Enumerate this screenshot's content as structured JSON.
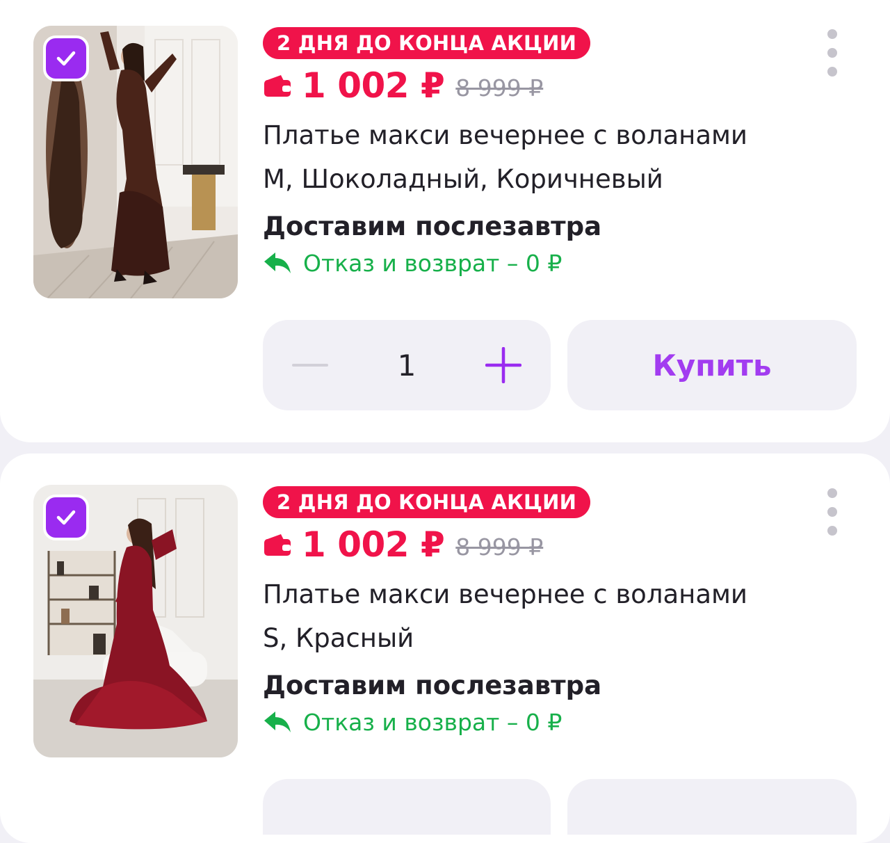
{
  "colors": {
    "accent_purple": "#9a2bf0",
    "sale_red": "#f0134a",
    "refund_green": "#17b04a",
    "old_price_gray": "#9896a2",
    "page_bg": "#f1f0f6"
  },
  "products": [
    {
      "selected": true,
      "promo_label": "2 ДНЯ ДО КОНЦА АКЦИИ",
      "price": "1 002 ₽",
      "old_price": "8 999 ₽",
      "title": "Платье макси вечернее с воланами",
      "variant": "M, Шоколадный, Коричневый",
      "delivery": "Доставим послезавтра",
      "refund": "Отказ и возврат – 0 ₽",
      "quantity": "1",
      "buy_label": "Купить",
      "icons": [
        "check-icon",
        "wallet-icon",
        "return-arrow-icon",
        "more-dots-icon",
        "minus-icon",
        "plus-icon"
      ]
    },
    {
      "selected": true,
      "promo_label": "2 ДНЯ ДО КОНЦА АКЦИИ",
      "price": "1 002 ₽",
      "old_price": "8 999 ₽",
      "title": "Платье макси вечернее с воланами",
      "variant": "S, Красный",
      "delivery": "Доставим послезавтра",
      "refund": "Отказ и возврат – 0 ₽",
      "icons": [
        "check-icon",
        "wallet-icon",
        "return-arrow-icon",
        "more-dots-icon"
      ]
    }
  ]
}
